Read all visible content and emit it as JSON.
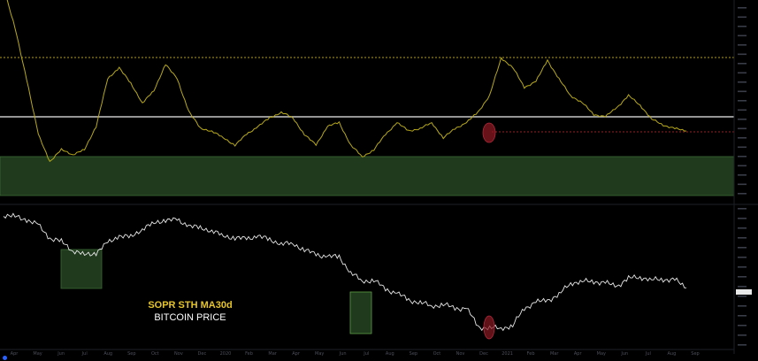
{
  "legend": {
    "line1": "SOPR STH MA30d",
    "line2": "BITCOIN PRICE"
  },
  "colors": {
    "background": "#000000",
    "sopr_line": "#b8a91a",
    "price_line": "#e8e8e8",
    "reference_line": "#c8c8c8",
    "dotted_top": "#b8a020",
    "dotted_red": "#cc2a2a",
    "band_green": "#1f3a1d",
    "box_green": "#2f5a2a",
    "marker_red": "#a01e2a"
  },
  "x_axis": {
    "labels": [
      "Apr",
      "May",
      "Jun",
      "Jul",
      "Aug",
      "Sep",
      "Oct",
      "Nov",
      "Dec",
      "2020",
      "Feb",
      "Mar",
      "Apr",
      "May",
      "Jun",
      "Jul",
      "Aug",
      "Sep",
      "Oct",
      "Nov",
      "Dec",
      "2021",
      "Feb",
      "Mar",
      "Apr",
      "May",
      "Jun",
      "Jul",
      "Aug",
      "Sep"
    ]
  },
  "chart_data": [
    {
      "type": "line",
      "name": "SOPR STH MA30d",
      "reference_lines": [
        {
          "value": 1.0,
          "style": "solid"
        }
      ],
      "x": [
        0,
        5,
        10,
        15,
        20,
        25,
        30,
        35,
        40,
        45,
        50,
        55,
        60,
        65,
        70,
        75,
        80,
        85,
        90,
        95,
        100,
        105,
        110,
        115,
        120,
        125,
        130,
        135,
        140,
        145,
        150,
        155,
        160,
        165,
        170,
        175,
        180,
        185,
        190,
        195,
        200,
        205,
        210,
        215,
        220,
        225,
        230,
        235,
        240,
        245,
        250,
        255,
        260,
        265,
        270,
        275,
        280,
        285,
        290,
        295
      ],
      "values": [
        1.11,
        1.075,
        1.032,
        0.985,
        0.962,
        0.972,
        0.968,
        0.972,
        0.992,
        1.032,
        1.042,
        1.028,
        1.012,
        1.022,
        1.045,
        1.032,
        1.005,
        0.99,
        0.988,
        0.982,
        0.976,
        0.985,
        0.992,
        0.999,
        1.004,
        0.999,
        0.985,
        0.976,
        0.992,
        0.995,
        0.976,
        0.966,
        0.972,
        0.985,
        0.995,
        0.988,
        0.99,
        0.995,
        0.982,
        0.99,
        0.995,
        1.004,
        1.018,
        1.05,
        1.042,
        1.025,
        1.03,
        1.048,
        1.032,
        1.018,
        1.012,
        1.002,
        1.0,
        1.008,
        1.018,
        1.01,
        0.998,
        0.993,
        0.99,
        0.988
      ]
    },
    {
      "type": "line",
      "name": "BITCOIN PRICE",
      "x": [
        0,
        5,
        10,
        15,
        20,
        25,
        30,
        35,
        40,
        45,
        50,
        55,
        60,
        65,
        70,
        75,
        80,
        85,
        90,
        95,
        100,
        105,
        110,
        115,
        120,
        125,
        130,
        135,
        140,
        145,
        150,
        155,
        160,
        165,
        170,
        175,
        180,
        185,
        190,
        195,
        200,
        205,
        210,
        215,
        220,
        225,
        230,
        235,
        240,
        245,
        250,
        255,
        260,
        265,
        270,
        275,
        280,
        285,
        290,
        295
      ],
      "values": [
        60500,
        59500,
        57500,
        54000,
        46500,
        44800,
        40500,
        38500,
        39500,
        44000,
        48000,
        47000,
        52000,
        55000,
        57500,
        57000,
        54000,
        52000,
        51000,
        47500,
        47000,
        46000,
        48000,
        45500,
        44000,
        43500,
        41000,
        38500,
        38000,
        37500,
        31500,
        28500,
        29000,
        26000,
        25000,
        23000,
        22500,
        21500,
        22000,
        21000,
        21000,
        17000,
        16800,
        16800,
        17200,
        21000,
        22500,
        23000,
        24500,
        28000,
        28500,
        28500,
        28000,
        27000,
        29500,
        30000,
        29000,
        29200,
        29000,
        26500
      ]
    }
  ]
}
